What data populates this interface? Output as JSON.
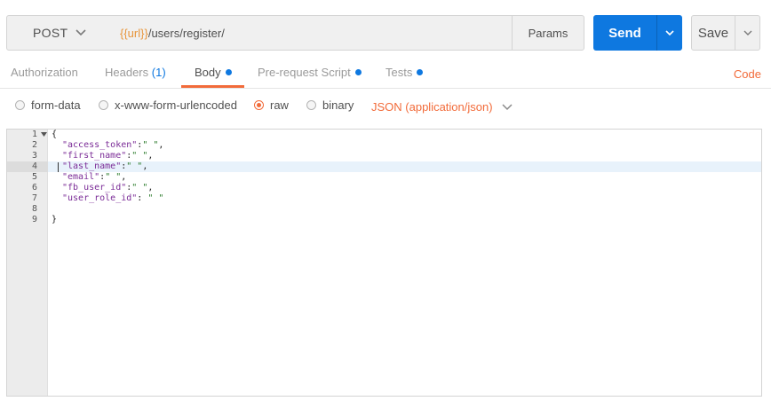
{
  "request": {
    "method": "POST",
    "url_variable": "{{url}}",
    "url_path": "/users/register/",
    "params_label": "Params",
    "send_label": "Send",
    "save_label": "Save"
  },
  "tabs": {
    "authorization": "Authorization",
    "headers": "Headers",
    "headers_count": "(1)",
    "body": "Body",
    "prerequest": "Pre-request Script",
    "tests": "Tests",
    "code": "Code",
    "active": "Body"
  },
  "body_options": {
    "form_data": "form-data",
    "urlencoded": "x-www-form-urlencoded",
    "raw": "raw",
    "binary": "binary",
    "selected": "raw",
    "format": "JSON (application/json)"
  },
  "editor": {
    "line_numbers": [
      "1",
      "2",
      "3",
      "4",
      "5",
      "6",
      "7",
      "8",
      "9"
    ],
    "open_brace": "{",
    "close_brace": "}",
    "fields": [
      {
        "key": "\"access_token\"",
        "sep": ":",
        "value": "\" \"",
        "trail": ","
      },
      {
        "key": "\"first_name\"",
        "sep": ":",
        "value": "\" \"",
        "trail": ","
      },
      {
        "key": "\"last_name\"",
        "sep": ":",
        "value": "\" \"",
        "trail": ","
      },
      {
        "key": "\"email\"",
        "sep": ":",
        "value": "\" \"",
        "trail": ","
      },
      {
        "key": "\"fb_user_id\"",
        "sep": ":",
        "value": "\" \"",
        "trail": ","
      },
      {
        "key": "\"user_role_id\"",
        "sep": ": ",
        "value": "\" \"",
        "trail": ""
      }
    ],
    "active_line": "4"
  },
  "colors": {
    "accent_orange": "#f26b3a",
    "send_blue": "#0e78e0",
    "json_key": "#7b2c97",
    "json_string": "#2a7b2a"
  },
  "icons": {
    "method_dropdown": "chevron-down-icon",
    "send_dropdown": "chevron-down-icon",
    "save_dropdown": "chevron-down-icon",
    "format_dropdown": "chevron-down-icon",
    "fold": "fold-triangle-icon"
  }
}
